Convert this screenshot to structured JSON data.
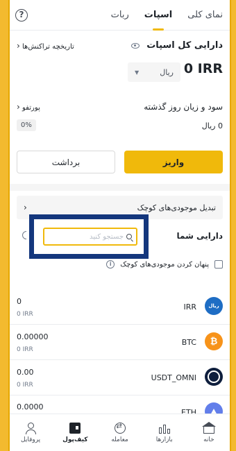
{
  "tabs": [
    {
      "label": "نمای کلی",
      "active": false
    },
    {
      "label": "اسپات",
      "active": true
    },
    {
      "label": "ربات",
      "active": false
    }
  ],
  "help_icon": "?",
  "balance": {
    "title": "دارایی کل اسپات",
    "history_link": "تاریخچه تراکنش‌ها",
    "amount": "0 IRR",
    "currency_select": "ریال"
  },
  "pnl": {
    "title": "سود و زیان روز گذشته",
    "portfolio_link": "پورتفو",
    "value": "0 ریال",
    "percent": "0%"
  },
  "actions": {
    "deposit": "واریز",
    "withdraw": "برداشت"
  },
  "convert_small": "تبدیل موجودی‌های کوچک",
  "assets": {
    "title": "دارایی شما",
    "search_placeholder": "جستجو کنید",
    "hide_small": "پنهان کردن موجودی‌های کوچک",
    "items": [
      {
        "symbol": "IRR",
        "coin_label": "ریال",
        "amount": "0",
        "sub": "0 IRR"
      },
      {
        "symbol": "BTC",
        "coin_label": "₿",
        "amount": "0.00000",
        "sub": "0 IRR"
      },
      {
        "symbol": "USDT_OMNI",
        "coin_label": "",
        "amount": "0.00",
        "sub": "0 IRR"
      },
      {
        "symbol": "ETH",
        "coin_label": "",
        "amount": "0.0000",
        "sub": ""
      }
    ]
  },
  "bottom_nav": [
    {
      "label": "خانه",
      "icon": "home-icon",
      "active": false
    },
    {
      "label": "بازارها",
      "icon": "markets-icon",
      "active": false
    },
    {
      "label": "معامله",
      "icon": "trade-icon",
      "active": false
    },
    {
      "label": "کیف‌پول",
      "icon": "wallet-icon",
      "active": true
    },
    {
      "label": "پروفایل",
      "icon": "profile-icon",
      "active": false
    }
  ],
  "colors": {
    "accent": "#F0B90B",
    "background_frame": "#F3BA2F",
    "highlight_box": "#14377D"
  }
}
